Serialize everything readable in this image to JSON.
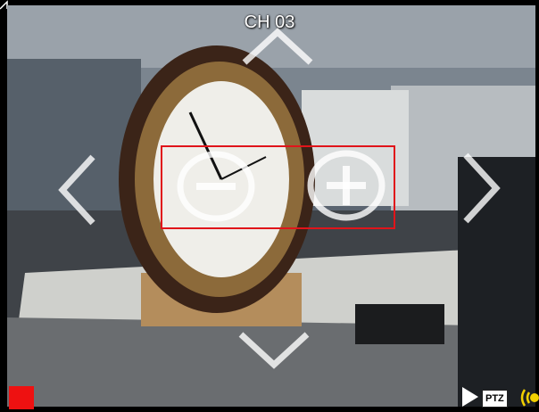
{
  "channel": {
    "title": "CH 03"
  },
  "controls": {
    "ptz_label": "PTZ"
  },
  "icons": {
    "ptz_up": "chevron-up-icon",
    "ptz_down": "chevron-down-icon",
    "ptz_left": "chevron-left-icon",
    "ptz_right": "chevron-right-icon",
    "zoom_out": "zoom-out-icon",
    "zoom_in": "zoom-in-icon",
    "record": "record-square-icon",
    "play": "play-icon",
    "audio": "speaker-icon"
  },
  "colors": {
    "record": "#ee1111",
    "roi_box": "#e0141a",
    "audio": "#f2d000",
    "overlay": "#ffffff"
  }
}
